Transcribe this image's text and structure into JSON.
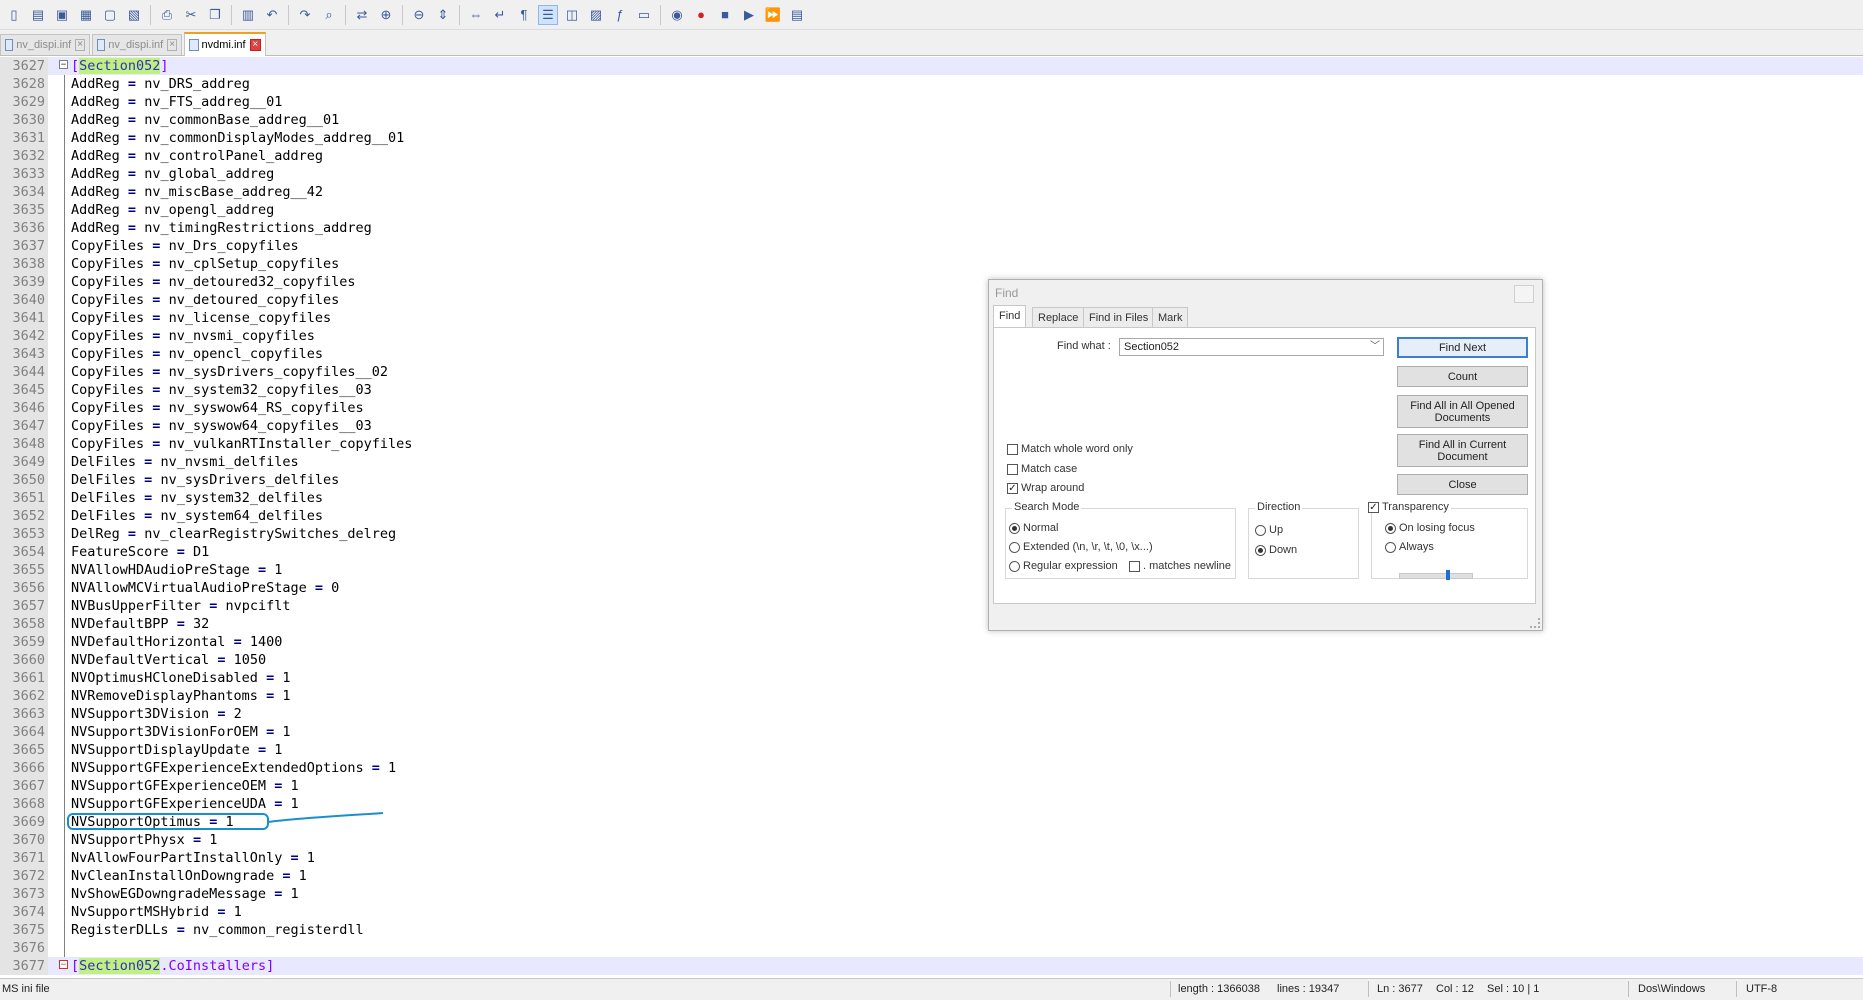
{
  "toolbar": {
    "icons": [
      "new-file",
      "open-file",
      "save",
      "save-all",
      "close",
      "close-all",
      "print",
      "cut",
      "copy",
      "paste",
      "undo",
      "redo",
      "find",
      "replace",
      "zoom-in",
      "zoom-out",
      "sync-vertical",
      "sync-horizontal",
      "word-wrap",
      "show-all-chars",
      "indent-guide",
      "udl",
      "doc-map",
      "function-list",
      "folder-workspace",
      "monitor",
      "record-macro",
      "stop-record",
      "playback",
      "run-macro-multiple",
      "save-macro"
    ]
  },
  "tabs": [
    {
      "label": "nv_dispi.inf",
      "active": false
    },
    {
      "label": "nv_dispi.inf",
      "active": false
    },
    {
      "label": "nvdmi.inf",
      "active": true
    }
  ],
  "editor": {
    "lines": [
      {
        "n": "3627",
        "k": "",
        "o": "",
        "v": "",
        "section": "[Section052]",
        "sec_found": "Section052",
        "fold": "minus",
        "hl": true
      },
      {
        "n": "3628",
        "k": "AddReg",
        "o": "=",
        "v": "nv_DRS_addreg"
      },
      {
        "n": "3629",
        "k": "AddReg",
        "o": "=",
        "v": "nv_FTS_addreg__01"
      },
      {
        "n": "3630",
        "k": "AddReg",
        "o": "=",
        "v": "nv_commonBase_addreg__01"
      },
      {
        "n": "3631",
        "k": "AddReg",
        "o": "=",
        "v": "nv_commonDisplayModes_addreg__01"
      },
      {
        "n": "3632",
        "k": "AddReg",
        "o": "=",
        "v": "nv_controlPanel_addreg"
      },
      {
        "n": "3633",
        "k": "AddReg",
        "o": "=",
        "v": "nv_global_addreg"
      },
      {
        "n": "3634",
        "k": "AddReg",
        "o": "=",
        "v": "nv_miscBase_addreg__42"
      },
      {
        "n": "3635",
        "k": "AddReg",
        "o": "=",
        "v": "nv_opengl_addreg"
      },
      {
        "n": "3636",
        "k": "AddReg",
        "o": "=",
        "v": "nv_timingRestrictions_addreg"
      },
      {
        "n": "3637",
        "k": "CopyFiles",
        "o": "=",
        "v": "nv_Drs_copyfiles"
      },
      {
        "n": "3638",
        "k": "CopyFiles",
        "o": "=",
        "v": "nv_cplSetup_copyfiles"
      },
      {
        "n": "3639",
        "k": "CopyFiles",
        "o": "=",
        "v": "nv_detoured32_copyfiles"
      },
      {
        "n": "3640",
        "k": "CopyFiles",
        "o": "=",
        "v": "nv_detoured_copyfiles"
      },
      {
        "n": "3641",
        "k": "CopyFiles",
        "o": "=",
        "v": "nv_license_copyfiles"
      },
      {
        "n": "3642",
        "k": "CopyFiles",
        "o": "=",
        "v": "nv_nvsmi_copyfiles"
      },
      {
        "n": "3643",
        "k": "CopyFiles",
        "o": "=",
        "v": "nv_opencl_copyfiles"
      },
      {
        "n": "3644",
        "k": "CopyFiles",
        "o": "=",
        "v": "nv_sysDrivers_copyfiles__02"
      },
      {
        "n": "3645",
        "k": "CopyFiles",
        "o": "=",
        "v": "nv_system32_copyfiles__03"
      },
      {
        "n": "3646",
        "k": "CopyFiles",
        "o": "=",
        "v": "nv_syswow64_RS_copyfiles"
      },
      {
        "n": "3647",
        "k": "CopyFiles",
        "o": "=",
        "v": "nv_syswow64_copyfiles__03"
      },
      {
        "n": "3648",
        "k": "CopyFiles",
        "o": "=",
        "v": "nv_vulkanRTInstaller_copyfiles"
      },
      {
        "n": "3649",
        "k": "DelFiles",
        "o": "=",
        "v": "nv_nvsmi_delfiles"
      },
      {
        "n": "3650",
        "k": "DelFiles",
        "o": "=",
        "v": "nv_sysDrivers_delfiles"
      },
      {
        "n": "3651",
        "k": "DelFiles",
        "o": "=",
        "v": "nv_system32_delfiles"
      },
      {
        "n": "3652",
        "k": "DelFiles",
        "o": "=",
        "v": "nv_system64_delfiles"
      },
      {
        "n": "3653",
        "k": "DelReg",
        "o": "=",
        "v": "nv_clearRegistrySwitches_delreg"
      },
      {
        "n": "3654",
        "k": "FeatureScore",
        "o": "=",
        "v": "D1"
      },
      {
        "n": "3655",
        "k": "NVAllowHDAudioPreStage",
        "o": "=",
        "v": "1"
      },
      {
        "n": "3656",
        "k": "NVAllowMCVirtualAudioPreStage",
        "o": "=",
        "v": "0"
      },
      {
        "n": "3657",
        "k": "NVBusUpperFilter",
        "o": "=",
        "v": "nvpciflt"
      },
      {
        "n": "3658",
        "k": "NVDefaultBPP",
        "o": "=",
        "v": "32"
      },
      {
        "n": "3659",
        "k": "NVDefaultHorizontal",
        "o": "=",
        "v": "1400"
      },
      {
        "n": "3660",
        "k": "NVDefaultVertical",
        "o": "=",
        "v": "1050"
      },
      {
        "n": "3661",
        "k": "NVOptimusHCloneDisabled",
        "o": "=",
        "v": "1"
      },
      {
        "n": "3662",
        "k": "NVRemoveDisplayPhantoms",
        "o": "=",
        "v": "1"
      },
      {
        "n": "3663",
        "k": "NVSupport3DVision",
        "o": "=",
        "v": "2"
      },
      {
        "n": "3664",
        "k": "NVSupport3DVisionForOEM",
        "o": "=",
        "v": "1"
      },
      {
        "n": "3665",
        "k": "NVSupportDisplayUpdate",
        "o": "=",
        "v": "1"
      },
      {
        "n": "3666",
        "k": "NVSupportGFExperienceExtendedOptions",
        "o": "=",
        "v": "1"
      },
      {
        "n": "3667",
        "k": "NVSupportGFExperienceOEM",
        "o": "=",
        "v": "1"
      },
      {
        "n": "3668",
        "k": "NVSupportGFExperienceUDA",
        "o": "=",
        "v": "1"
      },
      {
        "n": "3669",
        "k": "NVSupportOptimus",
        "o": "=",
        "v": "1"
      },
      {
        "n": "3670",
        "k": "NVSupportPhysx",
        "o": "=",
        "v": "1"
      },
      {
        "n": "3671",
        "k": "NvAllowFourPartInstallOnly",
        "o": "=",
        "v": "1"
      },
      {
        "n": "3672",
        "k": "NvCleanInstallOnDowngrade",
        "o": "=",
        "v": "1"
      },
      {
        "n": "3673",
        "k": "NvShowEGDowngradeMessage",
        "o": "=",
        "v": "1"
      },
      {
        "n": "3674",
        "k": "NvSupportMSHybrid",
        "o": "=",
        "v": "1"
      },
      {
        "n": "3675",
        "k": "RegisterDLLs",
        "o": "=",
        "v": "nv_common_registerdll"
      },
      {
        "n": "3676",
        "k": "",
        "o": "",
        "v": ""
      },
      {
        "n": "3677",
        "k": "",
        "o": "",
        "v": "",
        "section": "[Section052.CoInstallers]",
        "sec_found": "Section052",
        "fold": "red",
        "hl": true
      }
    ]
  },
  "find_dialog": {
    "title": "Find",
    "tabs": [
      "Find",
      "Replace",
      "Find in Files",
      "Mark"
    ],
    "find_what_label": "Find what :",
    "find_what_value": "Section052",
    "buttons": {
      "find_next": "Find Next",
      "count": "Count",
      "find_all_opened_1": "Find All in All Opened",
      "find_all_opened_2": "Documents",
      "find_all_current_1": "Find All in Current",
      "find_all_current_2": "Document",
      "close": "Close"
    },
    "checkboxes": {
      "match_whole_word": {
        "label": "Match whole word only",
        "checked": false
      },
      "match_case": {
        "label": "Match case",
        "checked": false
      },
      "wrap_around": {
        "label": "Wrap around",
        "checked": true
      }
    },
    "search_mode": {
      "title": "Search Mode",
      "normal": "Normal",
      "extended": "Extended (\\n, \\r, \\t, \\0, \\x...)",
      "regex": "Regular expression",
      "matches_newline": ". matches newline"
    },
    "direction": {
      "title": "Direction",
      "up": "Up",
      "down": "Down"
    },
    "transparency": {
      "title": "Transparency",
      "on_losing_focus": "On losing focus",
      "always": "Always",
      "level": 0.6
    }
  },
  "status_bar": {
    "file_type": "MS ini file",
    "length": "length : 1366038",
    "lines": "lines : 19347",
    "ln": "Ln : 3677",
    "col": "Col : 12",
    "sel": "Sel : 10 | 1",
    "eol": "Dos\\Windows",
    "encoding": "UTF-8"
  }
}
